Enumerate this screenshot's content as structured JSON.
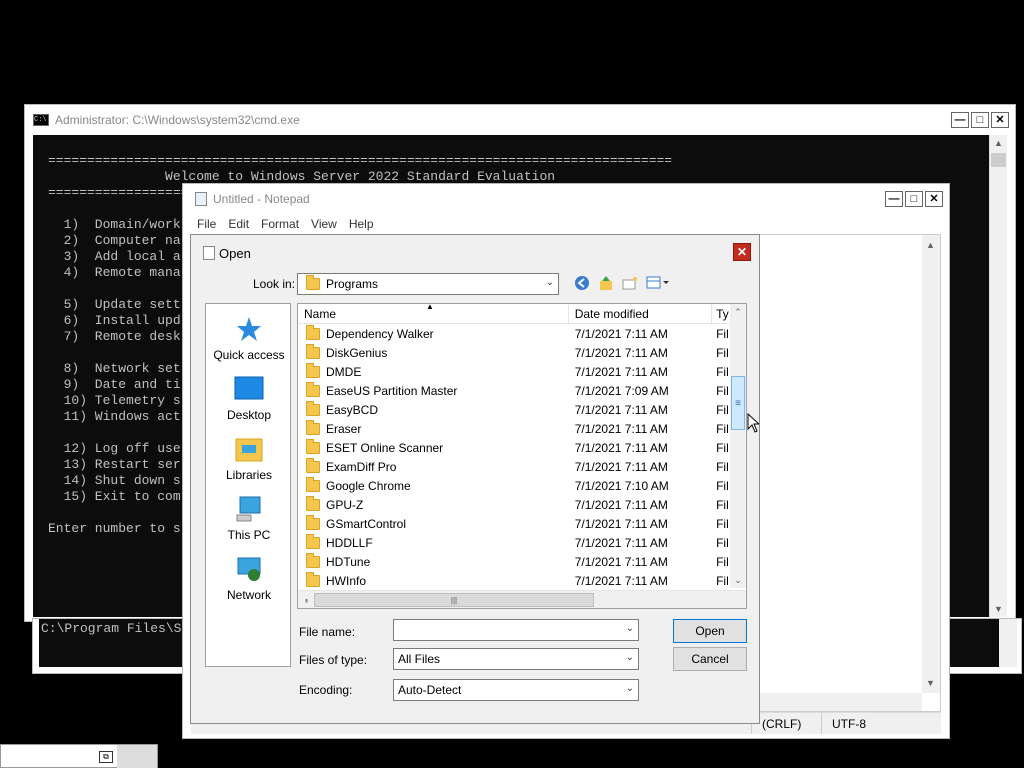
{
  "cmd": {
    "title": "Administrator: C:\\Windows\\system32\\cmd.exe",
    "lines": [
      "================================================================================",
      "               Welcome to Windows Server 2022 Standard Evaluation",
      "================================================================================",
      "",
      "  1)  Domain/work",
      "  2)  Computer na",
      "  3)  Add local a",
      "  4)  Remote mana",
      "",
      "  5)  Update sett",
      "  6)  Install upd",
      "  7)  Remote desk",
      "",
      "  8)  Network set",
      "  9)  Date and ti",
      "  10) Telemetry s",
      "  11) Windows act",
      "",
      "  12) Log off use",
      "  13) Restart ser",
      "  14) Shut down s",
      "  15) Exit to com",
      "",
      "Enter number to s"
    ]
  },
  "cmd2": {
    "line": "C:\\Program Files\\S"
  },
  "notepad": {
    "title": "Untitled - Notepad",
    "menu": [
      "File",
      "Edit",
      "Format",
      "View",
      "Help"
    ],
    "status": {
      "line_ending": "(CRLF)",
      "encoding": "UTF-8"
    }
  },
  "open_dialog": {
    "title": "Open",
    "look_in_label": "Look in:",
    "look_in_value": "Programs",
    "places": [
      "Quick access",
      "Desktop",
      "Libraries",
      "This PC",
      "Network"
    ],
    "columns": [
      "Name",
      "Date modified",
      "Ty"
    ],
    "files": [
      {
        "name": "Dependency Walker",
        "date": "7/1/2021 7:11 AM",
        "type": "Fil"
      },
      {
        "name": "DiskGenius",
        "date": "7/1/2021 7:11 AM",
        "type": "Fil"
      },
      {
        "name": "DMDE",
        "date": "7/1/2021 7:11 AM",
        "type": "Fil"
      },
      {
        "name": "EaseUS Partition Master",
        "date": "7/1/2021 7:09 AM",
        "type": "Fil"
      },
      {
        "name": "EasyBCD",
        "date": "7/1/2021 7:11 AM",
        "type": "Fil"
      },
      {
        "name": "Eraser",
        "date": "7/1/2021 7:11 AM",
        "type": "Fil"
      },
      {
        "name": "ESET Online Scanner",
        "date": "7/1/2021 7:11 AM",
        "type": "Fil"
      },
      {
        "name": "ExamDiff Pro",
        "date": "7/1/2021 7:11 AM",
        "type": "Fil"
      },
      {
        "name": "Google Chrome",
        "date": "7/1/2021 7:10 AM",
        "type": "Fil"
      },
      {
        "name": "GPU-Z",
        "date": "7/1/2021 7:11 AM",
        "type": "Fil"
      },
      {
        "name": "GSmartControl",
        "date": "7/1/2021 7:11 AM",
        "type": "Fil"
      },
      {
        "name": "HDDLLF",
        "date": "7/1/2021 7:11 AM",
        "type": "Fil"
      },
      {
        "name": "HDTune",
        "date": "7/1/2021 7:11 AM",
        "type": "Fil"
      },
      {
        "name": "HWInfo",
        "date": "7/1/2021 7:11 AM",
        "type": "Fil"
      }
    ],
    "file_name_label": "File name:",
    "file_name_value": "",
    "files_of_type_label": "Files of type:",
    "files_of_type_value": "All Files",
    "encoding_label": "Encoding:",
    "encoding_value": "Auto-Detect",
    "open_button": "Open",
    "cancel_button": "Cancel"
  }
}
